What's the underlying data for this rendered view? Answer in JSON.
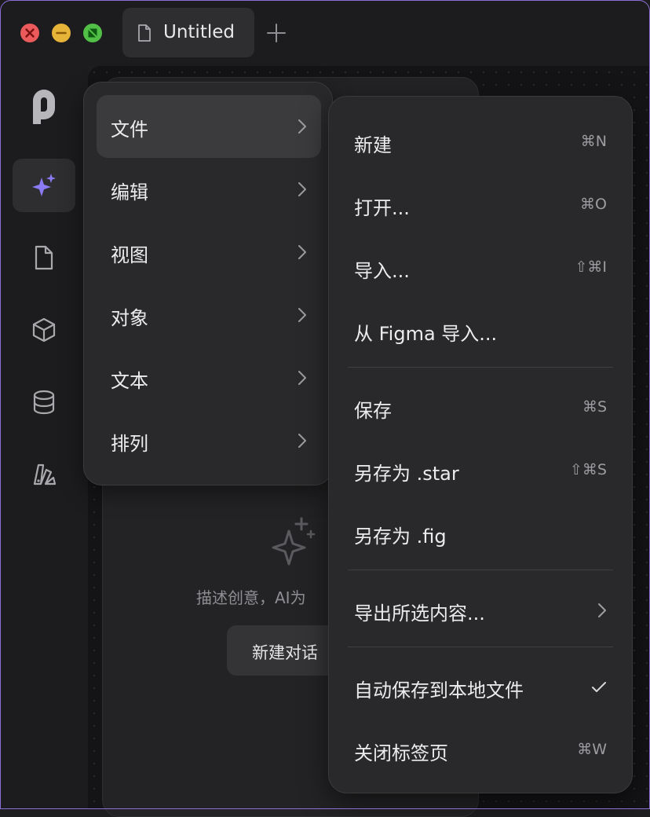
{
  "colors": {
    "accent": "#8b7cf6",
    "traffic_close": "#ec5b5b",
    "traffic_minimize": "#e7b43a",
    "traffic_maximize": "#52c047"
  },
  "titlebar": {
    "tab": {
      "title": "Untitled",
      "icon": "document-icon"
    },
    "new_tab_icon": "plus-icon"
  },
  "rail": {
    "logo_icon": "app-logo-icon",
    "items": [
      {
        "icon": "ai-sparkle-icon",
        "active": true
      },
      {
        "icon": "document-icon",
        "active": false
      },
      {
        "icon": "cube-icon",
        "active": false
      },
      {
        "icon": "database-icon",
        "active": false
      },
      {
        "icon": "swatches-icon",
        "active": false
      }
    ]
  },
  "ai_panel": {
    "hint": "描述创意，AI为",
    "new_chat_label": "新建对话"
  },
  "menu": {
    "items": [
      {
        "label": "文件",
        "active": true
      },
      {
        "label": "编辑"
      },
      {
        "label": "视图"
      },
      {
        "label": "对象"
      },
      {
        "label": "文本"
      },
      {
        "label": "排列"
      }
    ]
  },
  "submenu": {
    "items": [
      {
        "label": "新建",
        "shortcut": "⌘N"
      },
      {
        "label": "打开...",
        "shortcut": "⌘O"
      },
      {
        "label": "导入...",
        "shortcut": "⇧⌘I"
      },
      {
        "label": "从 Figma 导入...",
        "shortcut": ""
      },
      {
        "label": "保存",
        "shortcut": "⌘S"
      },
      {
        "label": "另存为 .star",
        "shortcut": "⇧⌘S"
      },
      {
        "label": "另存为 .fig",
        "shortcut": ""
      },
      {
        "label": "导出所选内容...",
        "submenu": true
      },
      {
        "label": "自动保存到本地文件",
        "checked": true
      },
      {
        "label": "关闭标签页",
        "shortcut": "⌘W"
      }
    ]
  }
}
